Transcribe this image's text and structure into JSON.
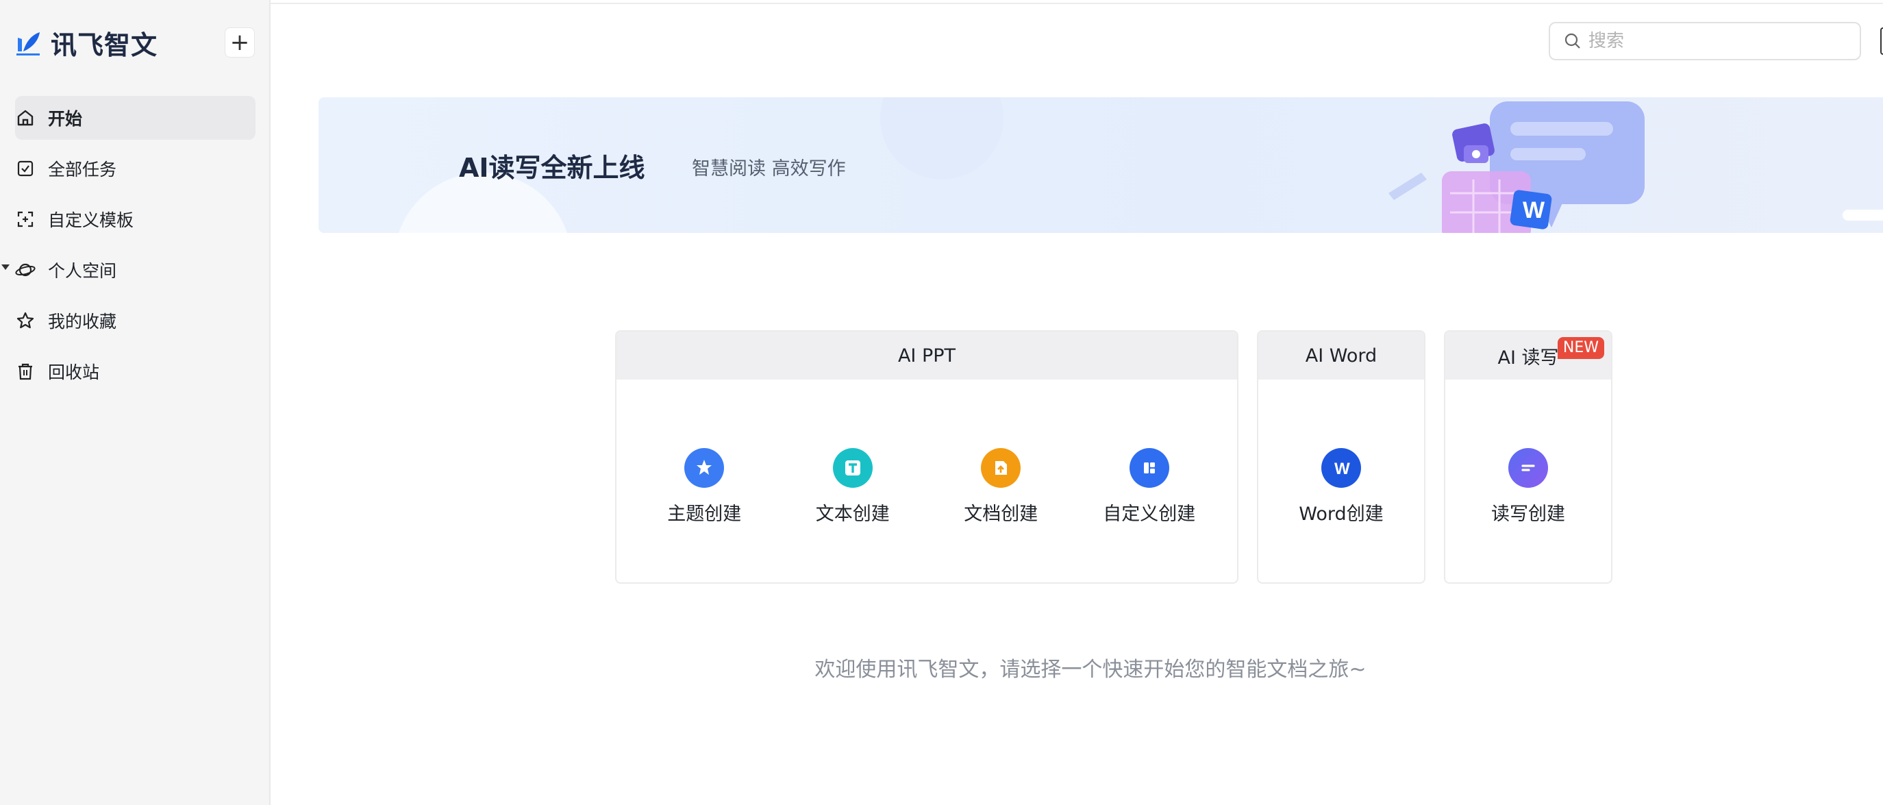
{
  "brand": {
    "name": "讯飞智文",
    "new_button": "+"
  },
  "sidebar": {
    "items": [
      {
        "label": "开始",
        "icon": "home-icon",
        "active": true
      },
      {
        "label": "全部任务",
        "icon": "check-square-icon"
      },
      {
        "label": "自定义模板",
        "icon": "template-scan-icon"
      },
      {
        "label": "个人空间",
        "icon": "planet-icon",
        "expandable": true
      },
      {
        "label": "我的收藏",
        "icon": "star-icon"
      },
      {
        "label": "回收站",
        "icon": "trash-icon"
      }
    ]
  },
  "search": {
    "placeholder": "搜索"
  },
  "banner": {
    "title": "AI读写全新上线",
    "subtitle": "智慧阅读 高效写作",
    "close": "×"
  },
  "cards": {
    "ppt": {
      "title": "AI PPT",
      "tiles": [
        {
          "label": "主题创建",
          "icon": "star-burst-icon",
          "color": "#3b7cf5"
        },
        {
          "label": "文本创建",
          "icon": "text-t-icon",
          "color": "#19c1c7"
        },
        {
          "label": "文档创建",
          "icon": "document-upload-icon",
          "color": "#f39c12"
        },
        {
          "label": "自定义创建",
          "icon": "grid-blocks-icon",
          "color": "#2f6ef0"
        }
      ]
    },
    "word": {
      "title": "AI Word",
      "tiles": [
        {
          "label": "Word创建",
          "icon": "word-w-icon",
          "color": "#1d57e0"
        }
      ]
    },
    "readwrite": {
      "title": "AI 读写",
      "badge": "NEW",
      "tiles": [
        {
          "label": "读写创建",
          "icon": "read-write-icon",
          "color": "#6b63f2"
        }
      ]
    }
  },
  "welcome": "欢迎使用讯飞智文，请选择一个快速开始您的智能文档之旅~"
}
